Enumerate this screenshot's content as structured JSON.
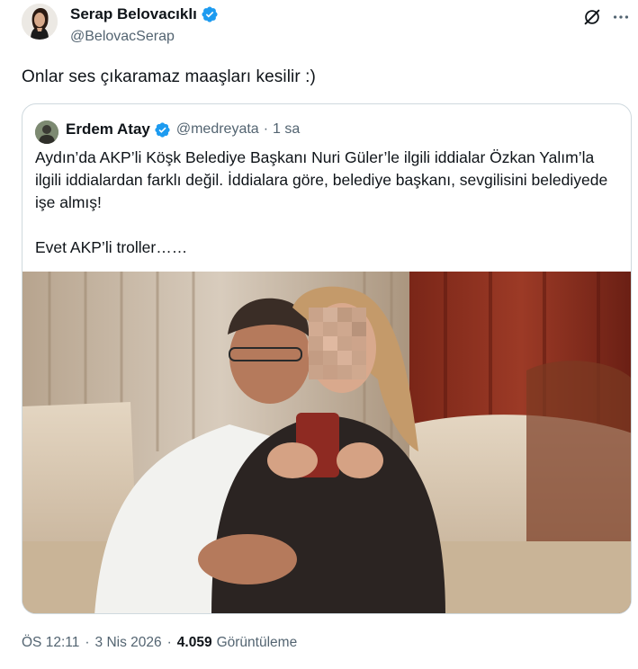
{
  "tweet": {
    "author_name": "Serap Belovacıklı",
    "author_handle": "@BelovacSerap",
    "text": "Onlar ses çıkaramaz maaşları kesilir :)",
    "time": "ÖS 12:11",
    "date": "3 Nis 2026",
    "views_count": "4.059",
    "views_label": "Görüntüleme",
    "dot": "·"
  },
  "quote": {
    "author_name": "Erdem Atay",
    "author_handle": "@medreyata",
    "time": "1 sa",
    "dot": "·",
    "text": "Aydın’da AKP’li Köşk Belediye Başkanı Nuri Güler’le ilgili iddialar Özkan Yalım’la ilgili iddialardan farklı değil.  İddialara göre, belediye başkanı, sevgilisini belediyede işe almış!\n\nEvet AKP’li troller……"
  },
  "icons": {
    "verified": "verified-badge-icon",
    "grok": "grok-icon",
    "more": "more-options-icon"
  },
  "colors": {
    "verified_blue": "#1d9bf0",
    "secondary_text": "#536471",
    "primary_text": "#0f1419",
    "border": "#cfd9de"
  }
}
